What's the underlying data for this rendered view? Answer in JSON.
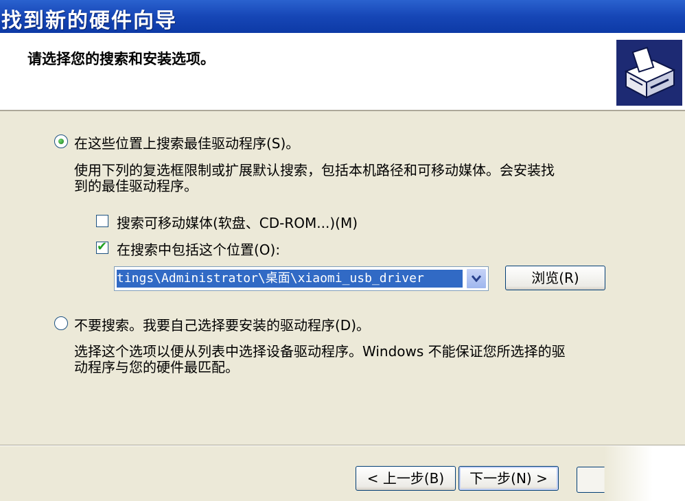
{
  "window": {
    "title": "找到新的硬件向导"
  },
  "header": {
    "heading": "请选择您的搜索和安装选项。",
    "icon": "hardware-wizard-icon"
  },
  "option_search": {
    "label": "在这些位置上搜索最佳驱动程序(S)。",
    "checked": true,
    "description_line1": "使用下列的复选框限制或扩展默认搜索，包括本机路径和可移动媒体。会安装找",
    "description_line2": "到的最佳驱动程序。",
    "removable_media": {
      "label": "搜索可移动媒体(软盘、CD-ROM...)(M)",
      "checked": false
    },
    "include_location": {
      "label": "在搜索中包括这个位置(O):",
      "checked": true
    },
    "location_value": "tings\\Administrator\\桌面\\xiaomi_usb_driver",
    "browse_label": "浏览(R)"
  },
  "option_manual": {
    "label": "不要搜索。我要自己选择要安装的驱动程序(D)。",
    "checked": false,
    "description_line1": "选择这个选项以便从列表中选择设备驱动程序。Windows 不能保证您所选择的驱",
    "description_line2": "动程序与您的硬件最匹配。"
  },
  "footer": {
    "back_label": "< 上一步(B)",
    "next_label": "下一步(N) >"
  },
  "colors": {
    "titlebar": "#1646b6",
    "dialog_bg": "#ece9d8",
    "selection": "#316ac5",
    "check_green": "#21a121"
  }
}
